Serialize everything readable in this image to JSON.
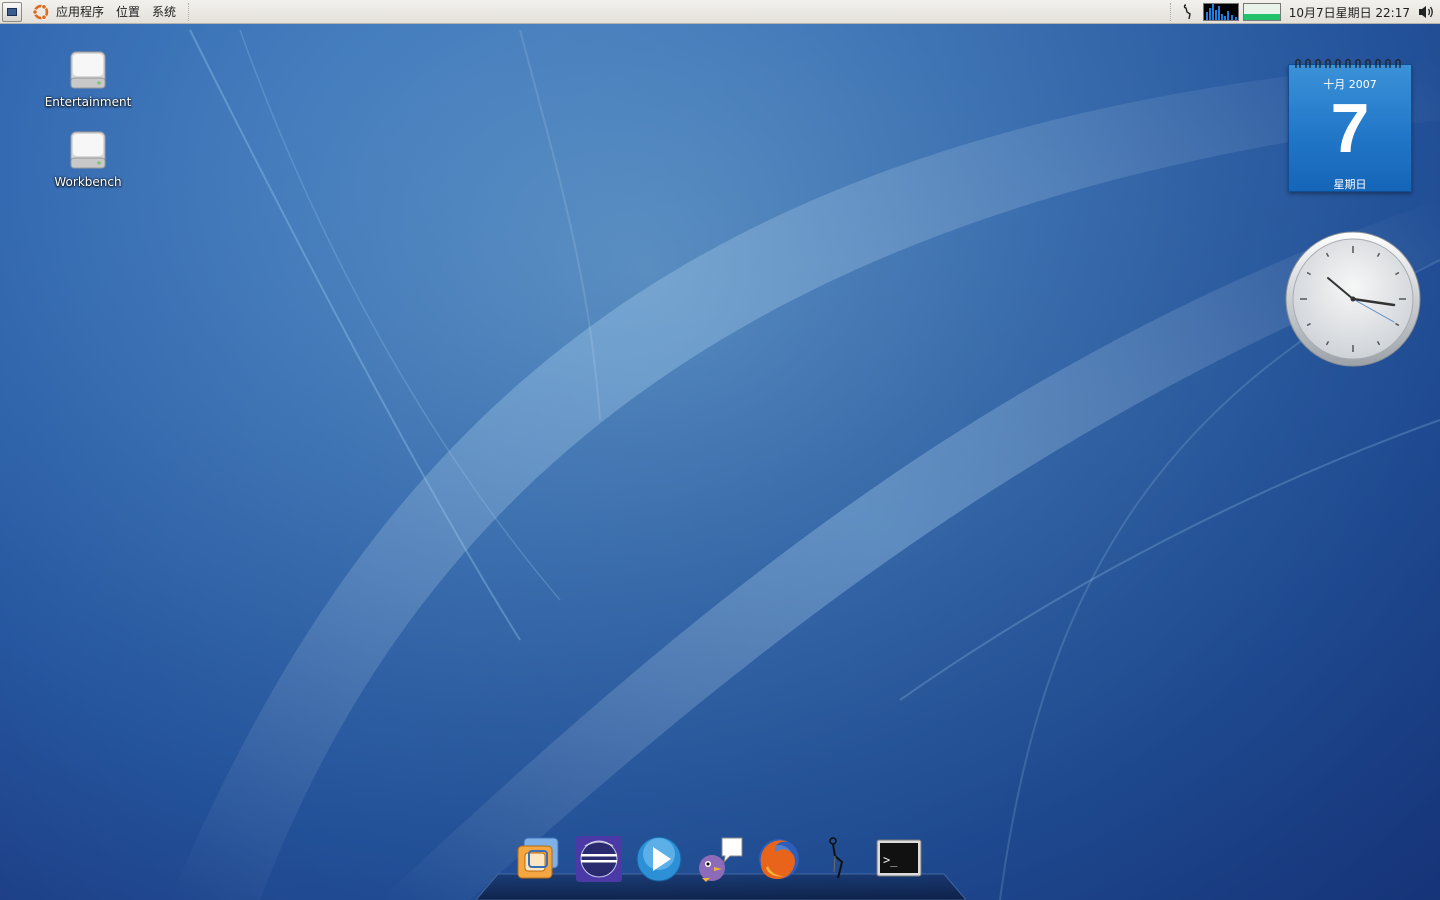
{
  "top_panel": {
    "menus": [
      "应用程序",
      "位置",
      "系统"
    ],
    "clock": "10月7日星期日 22:17"
  },
  "desktop_icons": [
    {
      "label": "Entertainment",
      "icon": "drive-icon"
    },
    {
      "label": "Workbench",
      "icon": "drive-icon"
    }
  ],
  "calendar": {
    "month_year": "十月 2007",
    "day": "7",
    "weekday": "星期日"
  },
  "clock_widget": {
    "time": "22:17"
  },
  "dock": {
    "items": [
      {
        "name": "vmware-icon"
      },
      {
        "name": "eclipse-icon"
      },
      {
        "name": "media-player-icon"
      },
      {
        "name": "pidgin-icon"
      },
      {
        "name": "firefox-icon"
      },
      {
        "name": "hearing-aid-icon"
      },
      {
        "name": "terminal-icon"
      }
    ]
  },
  "colors": {
    "panel": "#e9e6e1",
    "wallpaper": "#2c62ad",
    "calendar": "#2277c8"
  }
}
